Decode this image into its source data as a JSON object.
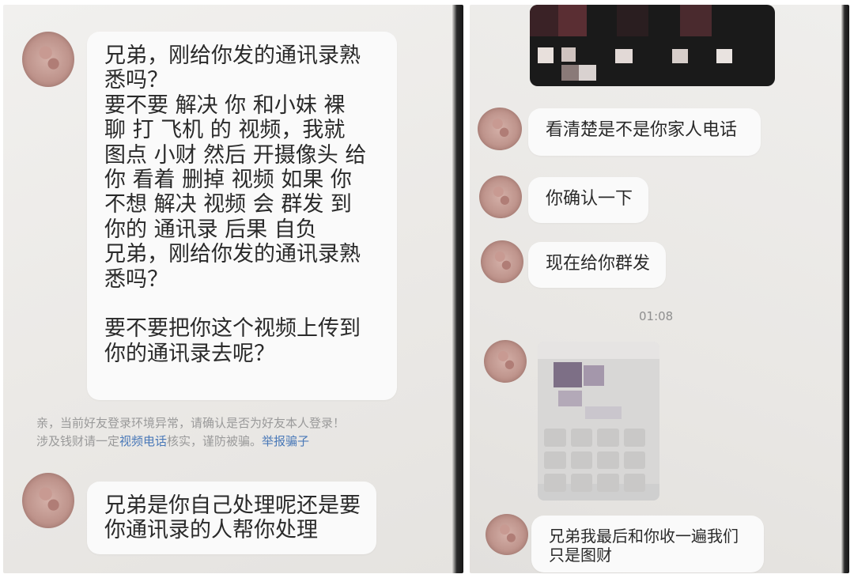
{
  "left_screenshot": {
    "messages": [
      {
        "text": "兄弟，刚给你发的通讯录熟\n悉吗？\n要不要 解决 你 和小妹 裸\n聊 打 飞机 的 视频，我就\n图点 小财 然后 开摄像头 给\n你 看着 删掉 视频 如果 你\n不想 解决 视频 会 群发 到\n你的 通讯录 后果 自负\n兄弟，刚给你发的通讯录熟\n悉吗？\n\n要不要把你这个视频上传到\n你的通讯录去呢？"
      },
      {
        "text": "兄弟是你自己处理呢还是要\n你通讯录的人帮你处理"
      }
    ],
    "security_notice": {
      "line1": "亲，当前好友登录环境异常，请确认是否为好友本人登录！",
      "line2_prefix": "涉及钱财请一定",
      "video_call_link": "视频电话",
      "line2_middle": "核实，谨防被骗。",
      "report_link": "举报骗子"
    }
  },
  "right_screenshot": {
    "messages": [
      {
        "text": "看清楚是不是你家人电话"
      },
      {
        "text": "你确认一下"
      },
      {
        "text": "现在给你群发"
      },
      {
        "text": "兄弟我最后和你收一遍我们\n只是图财"
      }
    ],
    "timestamp": "01:08"
  },
  "colors": {
    "bubble": "#fafafa",
    "background": "#ebe9e6",
    "link": "#4a79b8",
    "notice_text": "#9a9a9a",
    "message_text": "#2a2a2a"
  },
  "icons": {
    "avatar": "contact-avatar-icon"
  }
}
